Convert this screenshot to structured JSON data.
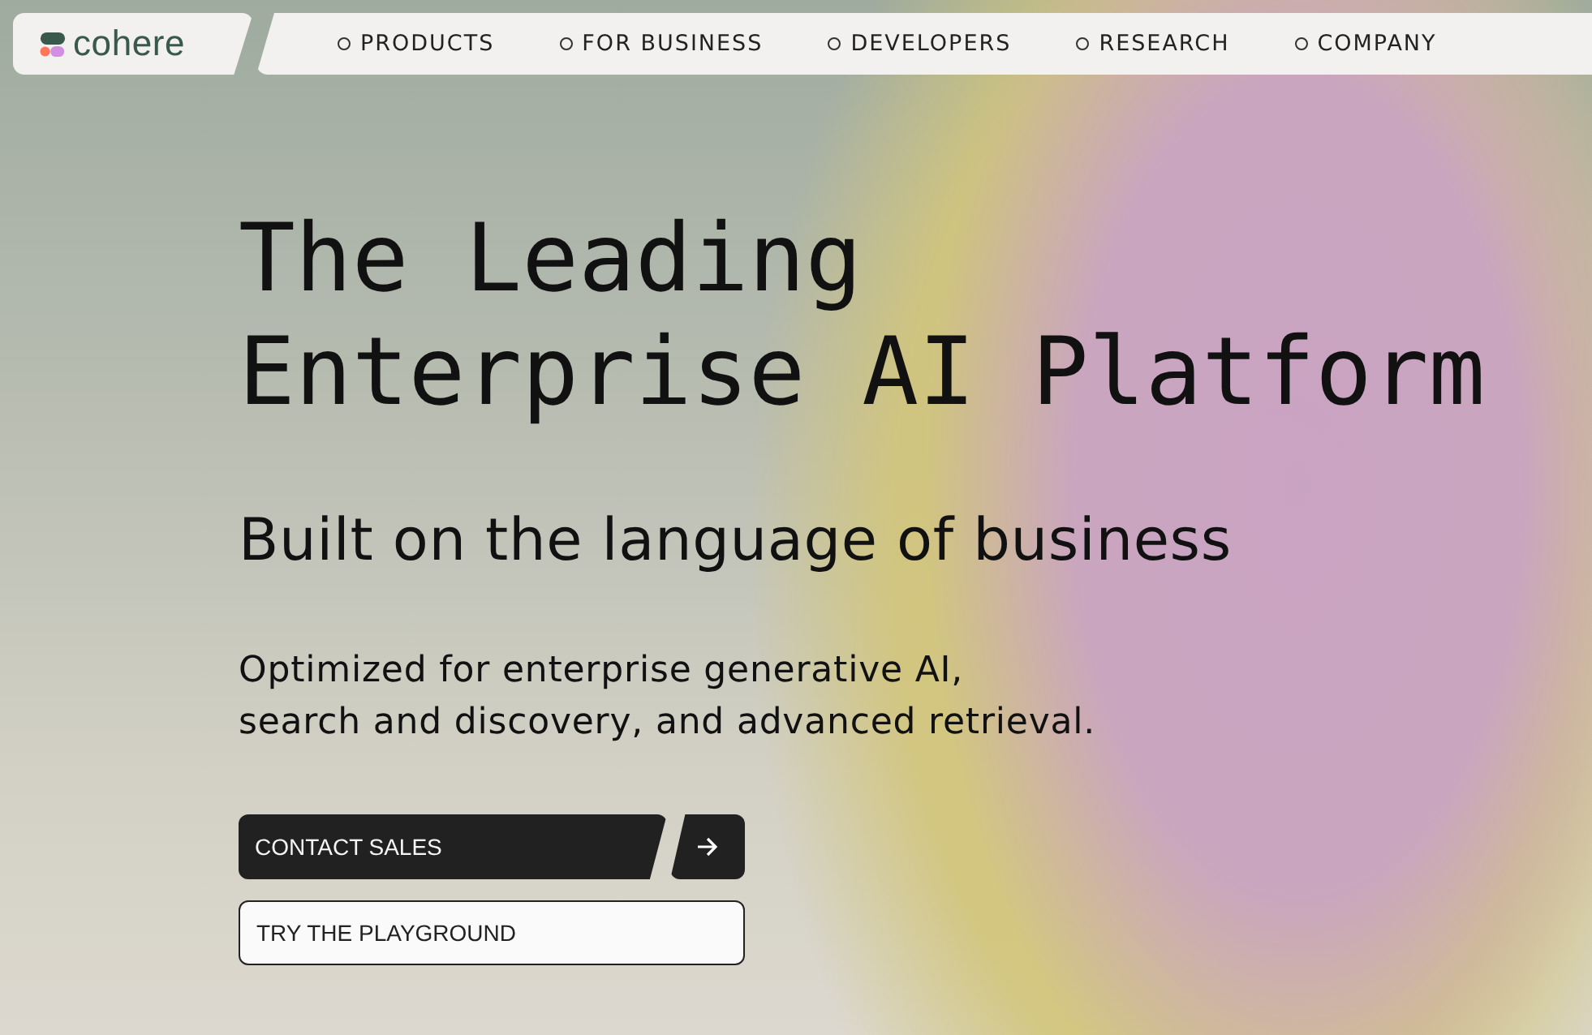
{
  "logo": {
    "text": "cohere"
  },
  "nav": [
    {
      "label": "PRODUCTS"
    },
    {
      "label": "FOR BUSINESS"
    },
    {
      "label": "DEVELOPERS"
    },
    {
      "label": "RESEARCH"
    },
    {
      "label": "COMPANY"
    }
  ],
  "hero": {
    "title_lines": [
      "The Leading",
      "Enterprise AI Platform"
    ],
    "subtitle": "Built on the language of business",
    "description_lines": [
      "Optimized for enterprise generative AI,",
      "search and discovery, and advanced retrieval."
    ]
  },
  "buttons": [
    {
      "kind": "primary",
      "label": "CONTACT SALES"
    },
    {
      "kind": "secondary",
      "label": "TRY THE PLAYGROUND"
    }
  ]
}
